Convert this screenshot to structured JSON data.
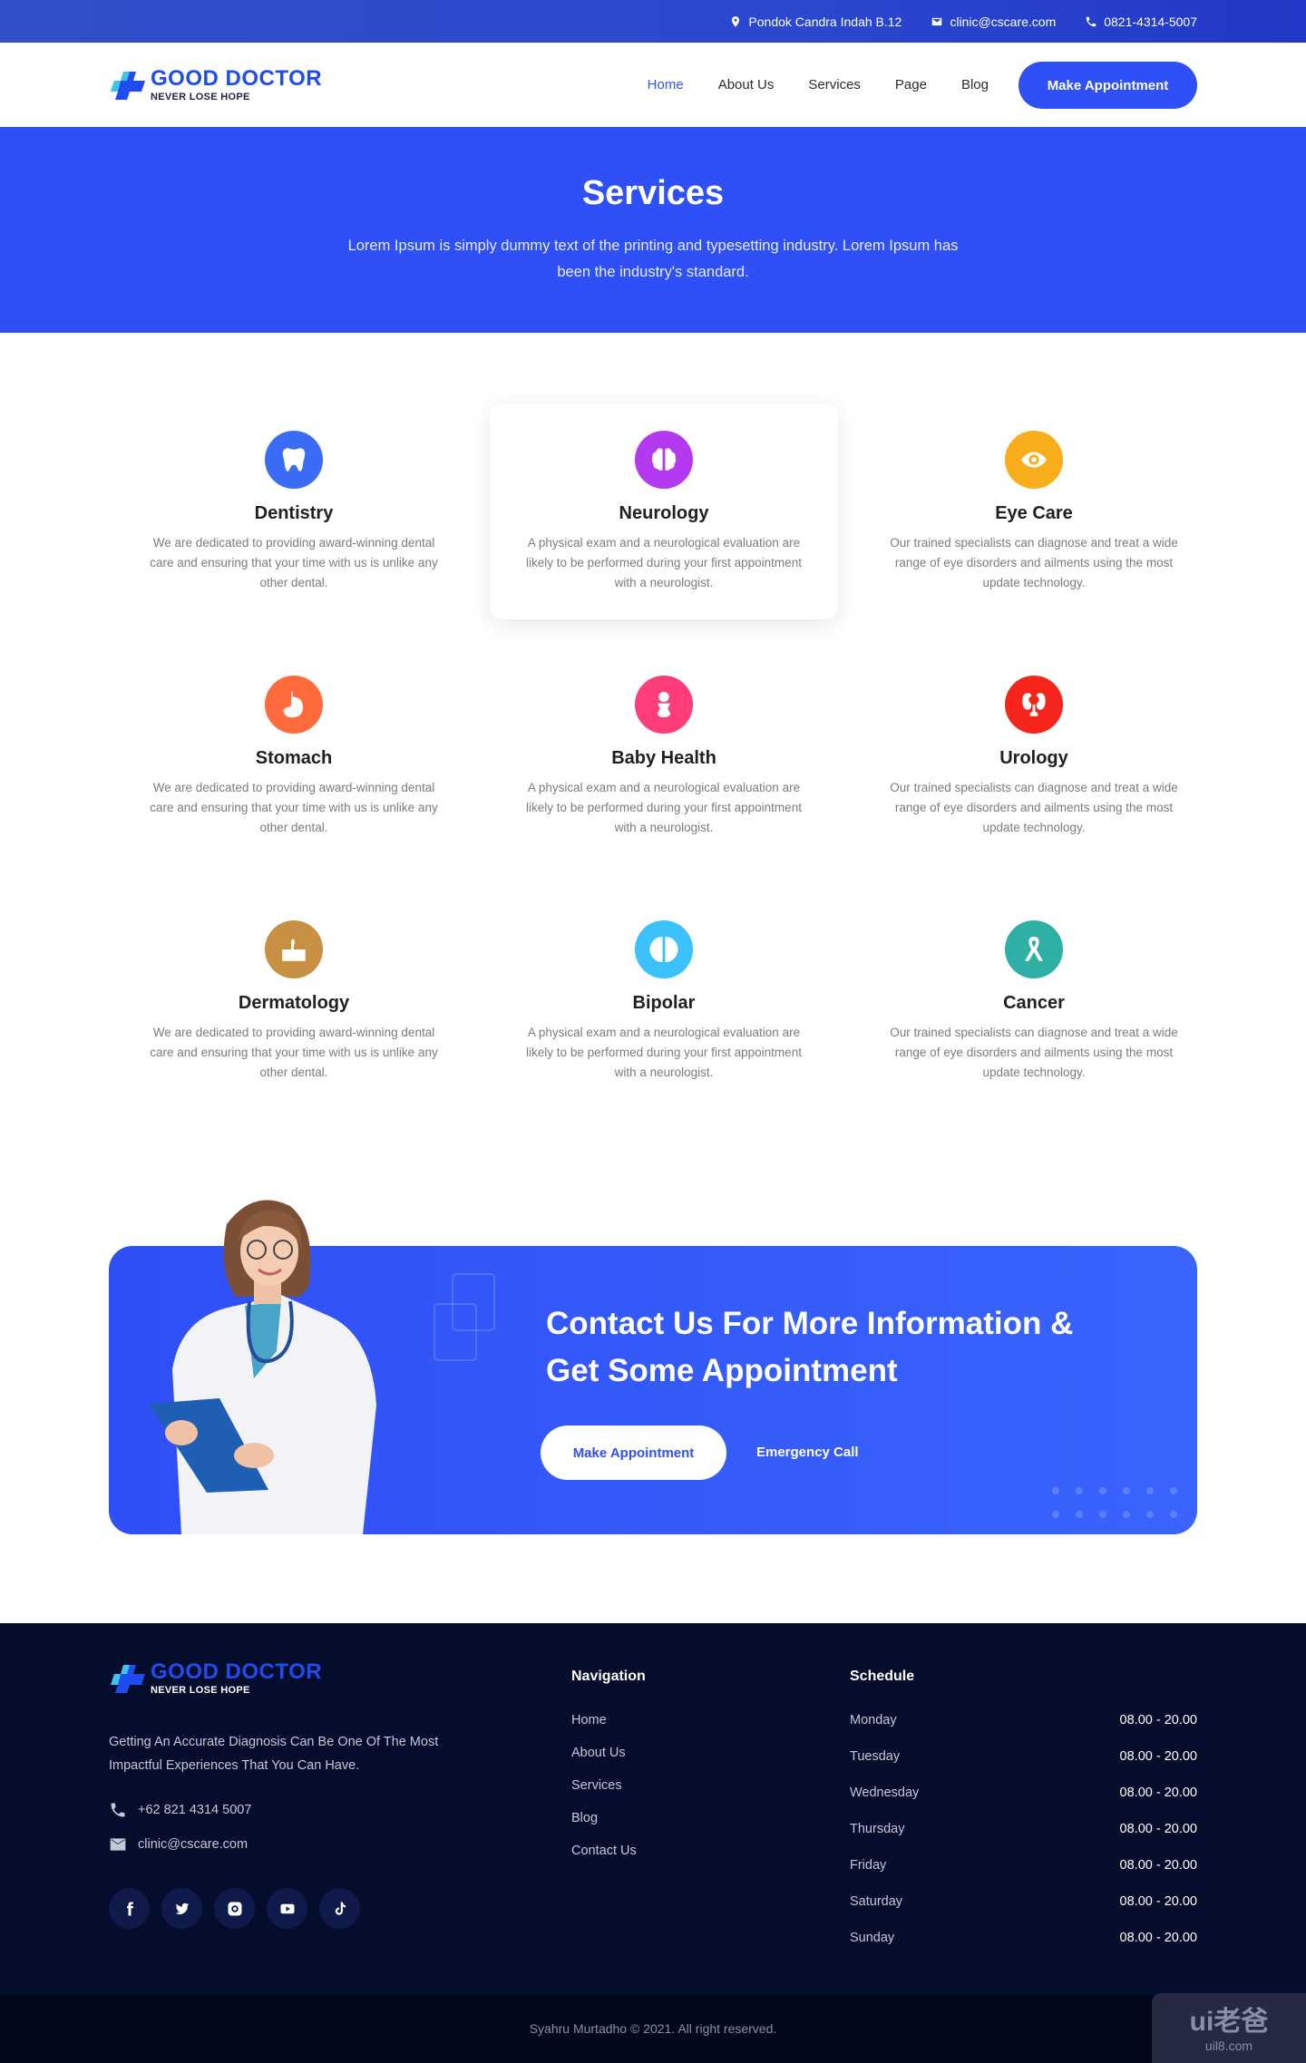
{
  "topbar": {
    "address": "Pondok Candra Indah B.12",
    "email": "clinic@cscare.com",
    "phone": "0821-4314-5007"
  },
  "brand": {
    "name": "GOOD DOCTOR",
    "tagline": "NEVER LOSE HOPE"
  },
  "nav": {
    "links": [
      "Home",
      "About Us",
      "Services",
      "Page",
      "Blog"
    ],
    "active": "Home",
    "cta": "Make Appointment"
  },
  "hero": {
    "title": "Services",
    "subtitle": "Lorem Ipsum is simply dummy text of the printing and typesetting industry. Lorem Ipsum has been the industry's standard."
  },
  "services": [
    {
      "title": "Dentistry",
      "icon": "tooth-icon",
      "color": "#3b6cf6",
      "desc": "We are dedicated to providing award-winning dental care and ensuring that your time with us is unlike any other dental."
    },
    {
      "title": "Neurology",
      "icon": "brain-icon",
      "color": "#b43af2",
      "desc": "A physical exam and a neurological evaluation are likely to be performed during your first appointment with a neurologist."
    },
    {
      "title": "Eye Care",
      "icon": "eye-icon",
      "color": "#f8ae1a",
      "desc": "Our trained specialists can diagnose and treat a wide range of eye disorders and ailments using the most update technology."
    },
    {
      "title": "Stomach",
      "icon": "stomach-icon",
      "color": "#ff6b3d",
      "desc": "We are dedicated to providing award-winning dental care and ensuring that your time with us is unlike any other dental."
    },
    {
      "title": "Baby Health",
      "icon": "baby-icon",
      "color": "#ff3d78",
      "desc": "A physical exam and a neurological evaluation are likely to be performed during your first appointment with a neurologist."
    },
    {
      "title": "Urology",
      "icon": "kidney-icon",
      "color": "#f5251c",
      "desc": "Our trained specialists can diagnose and treat a wide range of eye disorders and ailments using the most update technology."
    },
    {
      "title": "Dermatology",
      "icon": "skin-icon",
      "color": "#c79042",
      "desc": "We are dedicated to providing award-winning dental care and ensuring that your time with us is unlike any other dental."
    },
    {
      "title": "Bipolar",
      "icon": "bipolar-icon",
      "color": "#3cc2fb",
      "desc": "A physical exam and a neurological evaluation are likely to be performed during your first appointment with a neurologist."
    },
    {
      "title": "Cancer",
      "icon": "ribbon-icon",
      "color": "#2fb0a6",
      "desc": "Our trained specialists can diagnose and treat a wide range of eye disorders and ailments using the most update technology."
    }
  ],
  "cta": {
    "title": "Contact Us For More Information & Get Some Appointment",
    "primary": "Make Appointment",
    "secondary": "Emergency Call"
  },
  "footer": {
    "about": "Getting An Accurate Diagnosis Can Be One Of The Most Impactful Experiences That You Can Have.",
    "phone": "+62 821 4314 5007",
    "email": "clinic@cscare.com",
    "social": [
      "facebook-icon",
      "twitter-icon",
      "instagram-icon",
      "youtube-icon",
      "tiktok-icon"
    ],
    "navigation_title": "Navigation",
    "navigation": [
      "Home",
      "About Us",
      "Services",
      "Blog",
      "Contact Us"
    ],
    "schedule_title": "Schedule",
    "schedule": [
      {
        "day": "Monday",
        "time": "08.00 - 20.00"
      },
      {
        "day": "Tuesday",
        "time": "08.00 - 20.00"
      },
      {
        "day": "Wednesday",
        "time": "08.00 - 20.00"
      },
      {
        "day": "Thursday",
        "time": "08.00 - 20.00"
      },
      {
        "day": "Friday",
        "time": "08.00 - 20.00"
      },
      {
        "day": "Saturday",
        "time": "08.00 - 20.00"
      },
      {
        "day": "Sunday",
        "time": "08.00 - 20.00"
      }
    ],
    "copyright": "Syahru Murtadho © 2021. All right reserved."
  },
  "watermark": {
    "line1": "ui老爸",
    "line2": "uil8.com"
  },
  "colors": {
    "primary": "#2f4ff7",
    "footer_bg": "#040d2c"
  }
}
